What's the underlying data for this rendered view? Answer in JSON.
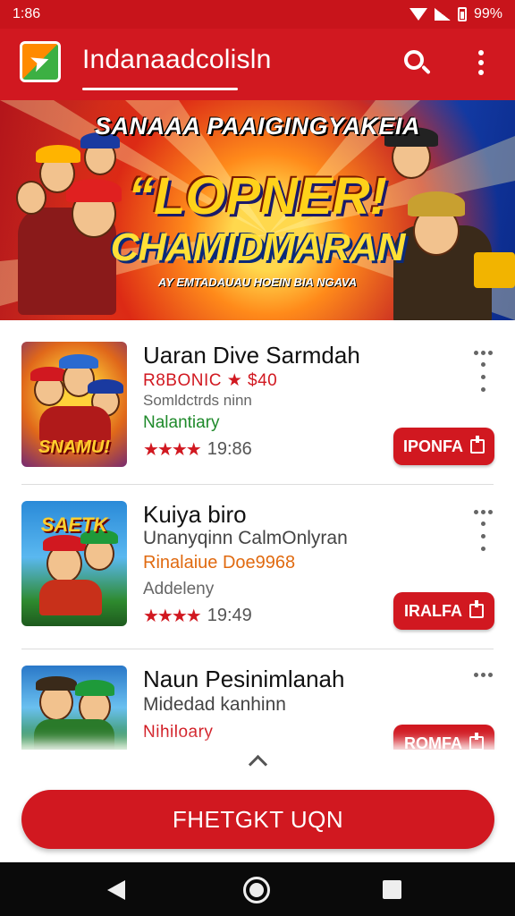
{
  "status_bar": {
    "time": "1:86",
    "battery": "99%"
  },
  "app_bar": {
    "title": "Indanaadcolisln"
  },
  "banner": {
    "top_text": "SANAAA PAAIGINGYAKEIA",
    "main_text": "“LOPNER!",
    "second_text": "CHAMIDMARAN",
    "sub_text": "AY EMTADAUAU HOEIN BIA NGAVA"
  },
  "apps": [
    {
      "name": "Uaran Dive Sarmdah",
      "line1": "R8BONIC ★ $40",
      "line2": "Somldctrds ninn",
      "line3": "Nalantiary",
      "rating": "19:86",
      "stars": "★★★★",
      "action": "IPONFA",
      "thumb_label": "SNAMU!"
    },
    {
      "name": "Kuiya biro",
      "line1": "Unanyqinn CalmOnlyran",
      "line2": "Rinalaiue Doe9968",
      "line3": "Addeleny",
      "rating": "19:49",
      "stars": "★★★★",
      "action": "IRALFA",
      "thumb_label": "SAETK"
    },
    {
      "name": "Naun Pesinimlanah",
      "line1": "Midedad kanhinn",
      "line2": "Nihiloary",
      "action": "ROMFA"
    }
  ],
  "cta": {
    "label": "FHETGKT UQN"
  },
  "colors": {
    "brand_red": "#d11820",
    "status_red": "#c8141b",
    "star_red": "#d11820",
    "green_text": "#1f8a2b",
    "orange_text": "#e06a10"
  }
}
